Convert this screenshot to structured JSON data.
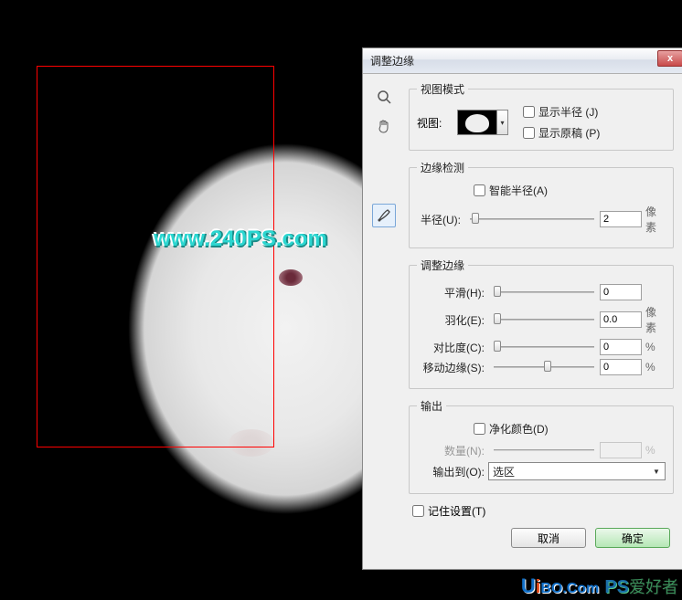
{
  "watermark_text": "www.240PS.com",
  "dialog": {
    "title": "调整边缘",
    "close_glyph": "x",
    "tools": {
      "zoom": "zoom-icon",
      "hand": "hand-icon",
      "brush": "brush-icon"
    },
    "view_mode": {
      "legend": "视图模式",
      "view_label": "视图:",
      "show_radius": "显示半径 (J)",
      "show_original": "显示原稿 (P)"
    },
    "edge_detect": {
      "legend": "边缘检测",
      "smart_radius": "智能半径(A)",
      "radius_label": "半径(U):",
      "radius_value": "2",
      "radius_unit": "像素"
    },
    "adjust_edge": {
      "legend": "调整边缘",
      "smooth_label": "平滑(H):",
      "smooth_value": "0",
      "feather_label": "羽化(E):",
      "feather_value": "0.0",
      "feather_unit": "像素",
      "contrast_label": "对比度(C):",
      "contrast_value": "0",
      "contrast_unit": "%",
      "shift_label": "移动边缘(S):",
      "shift_value": "0",
      "shift_unit": "%"
    },
    "output": {
      "legend": "输出",
      "decontaminate": "净化颜色(D)",
      "amount_label": "数量(N):",
      "amount_value": "",
      "amount_unit": "%",
      "output_to_label": "输出到(O):",
      "output_to_value": "选区"
    },
    "remember": "记住设置(T)",
    "cancel": "取消",
    "ok": "确定"
  },
  "footer": {
    "u": "U",
    "i": "i",
    "dom": "BO.Com",
    "ps": "PS",
    "zh": "爱好者"
  }
}
